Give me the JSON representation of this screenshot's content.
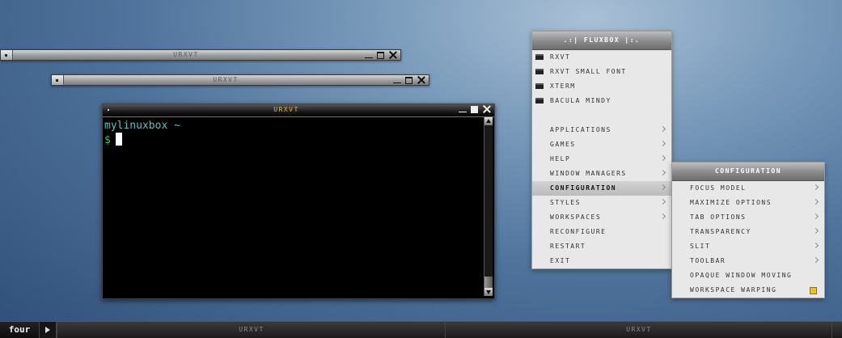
{
  "windows": {
    "shaded1": {
      "title": "URXVT"
    },
    "shaded2": {
      "title": "URXVT"
    },
    "terminal": {
      "title": "URXVT",
      "lines": [
        {
          "text": "mylinuxbox ~"
        },
        {
          "text": "$"
        }
      ]
    }
  },
  "root_menu": {
    "title": ".:| FLUXBOX |:.",
    "items": [
      {
        "label": "RXVT",
        "icon": "folder-icon"
      },
      {
        "label": "RXVT SMALL FONT",
        "icon": "folder-icon"
      },
      {
        "label": "XTERM",
        "icon": "folder-icon"
      },
      {
        "label": "BACULA MINDY",
        "icon": "folder-icon"
      },
      {
        "label": "APPLICATIONS",
        "submenu": true
      },
      {
        "label": "GAMES",
        "submenu": true
      },
      {
        "label": "HELP",
        "submenu": true
      },
      {
        "label": "WINDOW MANAGERS",
        "submenu": true
      },
      {
        "label": "CONFIGURATION",
        "submenu": true,
        "selected": true
      },
      {
        "label": "STYLES",
        "submenu": true
      },
      {
        "label": "WORKSPACES",
        "submenu": true
      },
      {
        "label": "RECONFIGURE"
      },
      {
        "label": "RESTART"
      },
      {
        "label": "EXIT"
      }
    ]
  },
  "config_menu": {
    "title": "CONFIGURATION",
    "items": [
      {
        "label": "FOCUS MODEL",
        "submenu": true
      },
      {
        "label": "MAXIMIZE OPTIONS",
        "submenu": true
      },
      {
        "label": "TAB OPTIONS",
        "submenu": true
      },
      {
        "label": "TRANSPARENCY",
        "submenu": true
      },
      {
        "label": "SLIT",
        "submenu": true
      },
      {
        "label": "TOOLBAR",
        "submenu": true
      },
      {
        "label": "OPAQUE WINDOW MOVING"
      },
      {
        "label": "WORKSPACE WARPING",
        "checked": true
      }
    ]
  },
  "taskbar": {
    "workspace": "four",
    "tasks": [
      {
        "label": "URXVT"
      },
      {
        "label": "URXVT"
      }
    ]
  },
  "colors": {
    "active_title": "#e8b13a",
    "prompt_host": "#5bc0c0",
    "prompt_symbol": "#4ac24a",
    "check_mark": "#f0c020"
  }
}
